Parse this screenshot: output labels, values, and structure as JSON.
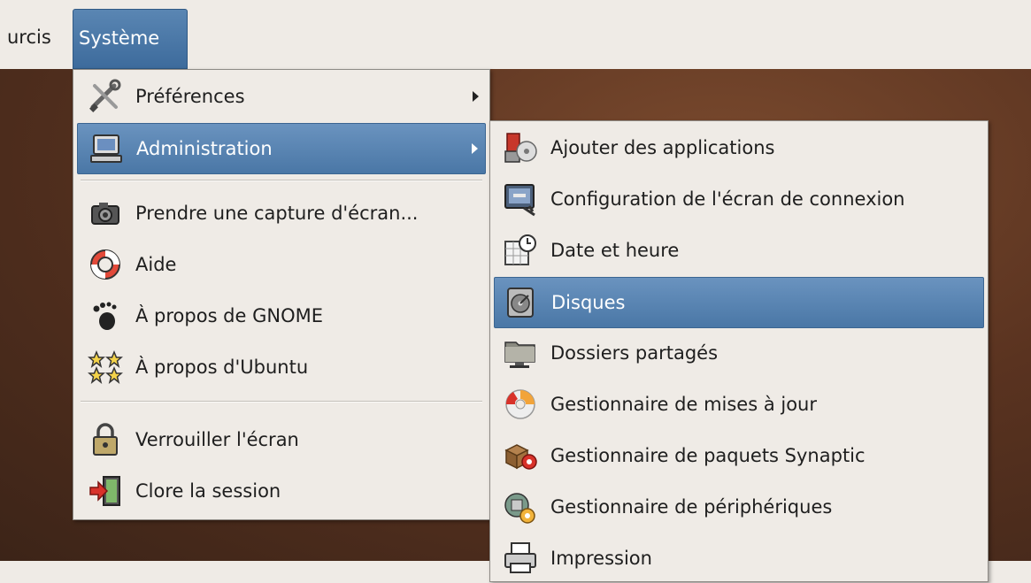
{
  "panel": {
    "left_item": "urcis",
    "system_menu": "Système"
  },
  "menu1": {
    "items": [
      {
        "label": "Préférences",
        "icon": "preferences-tools-icon",
        "submenu": true
      },
      {
        "label": "Administration",
        "icon": "computer-admin-icon",
        "submenu": true,
        "selected": true
      },
      {
        "label": "Prendre une capture d'écran...",
        "icon": "camera-icon"
      },
      {
        "label": "Aide",
        "icon": "lifebuoy-icon"
      },
      {
        "label": "À propos de GNOME",
        "icon": "gnome-foot-icon"
      },
      {
        "label": "À propos d'Ubuntu",
        "icon": "stars-icon"
      },
      {
        "label": "Verrouiller l'écran",
        "icon": "padlock-icon"
      },
      {
        "label": "Clore la session",
        "icon": "logout-door-icon"
      }
    ]
  },
  "menu2": {
    "items": [
      {
        "label": "Ajouter des applications",
        "icon": "add-apps-icon"
      },
      {
        "label": "Configuration de l'écran de connexion",
        "icon": "login-screen-icon"
      },
      {
        "label": "Date et heure",
        "icon": "calendar-clock-icon"
      },
      {
        "label": "Disques",
        "icon": "disk-icon",
        "selected": true
      },
      {
        "label": "Dossiers partagés",
        "icon": "shared-folder-icon"
      },
      {
        "label": "Gestionnaire de mises à jour",
        "icon": "update-cd-icon"
      },
      {
        "label": "Gestionnaire de paquets Synaptic",
        "icon": "synaptic-package-icon"
      },
      {
        "label": "Gestionnaire de périphériques",
        "icon": "device-manager-icon"
      },
      {
        "label": "Impression",
        "icon": "printer-icon"
      }
    ]
  },
  "colors": {
    "selection": "#4a77a6",
    "menu_bg": "#efebe6",
    "desktop": "#5a3320"
  }
}
